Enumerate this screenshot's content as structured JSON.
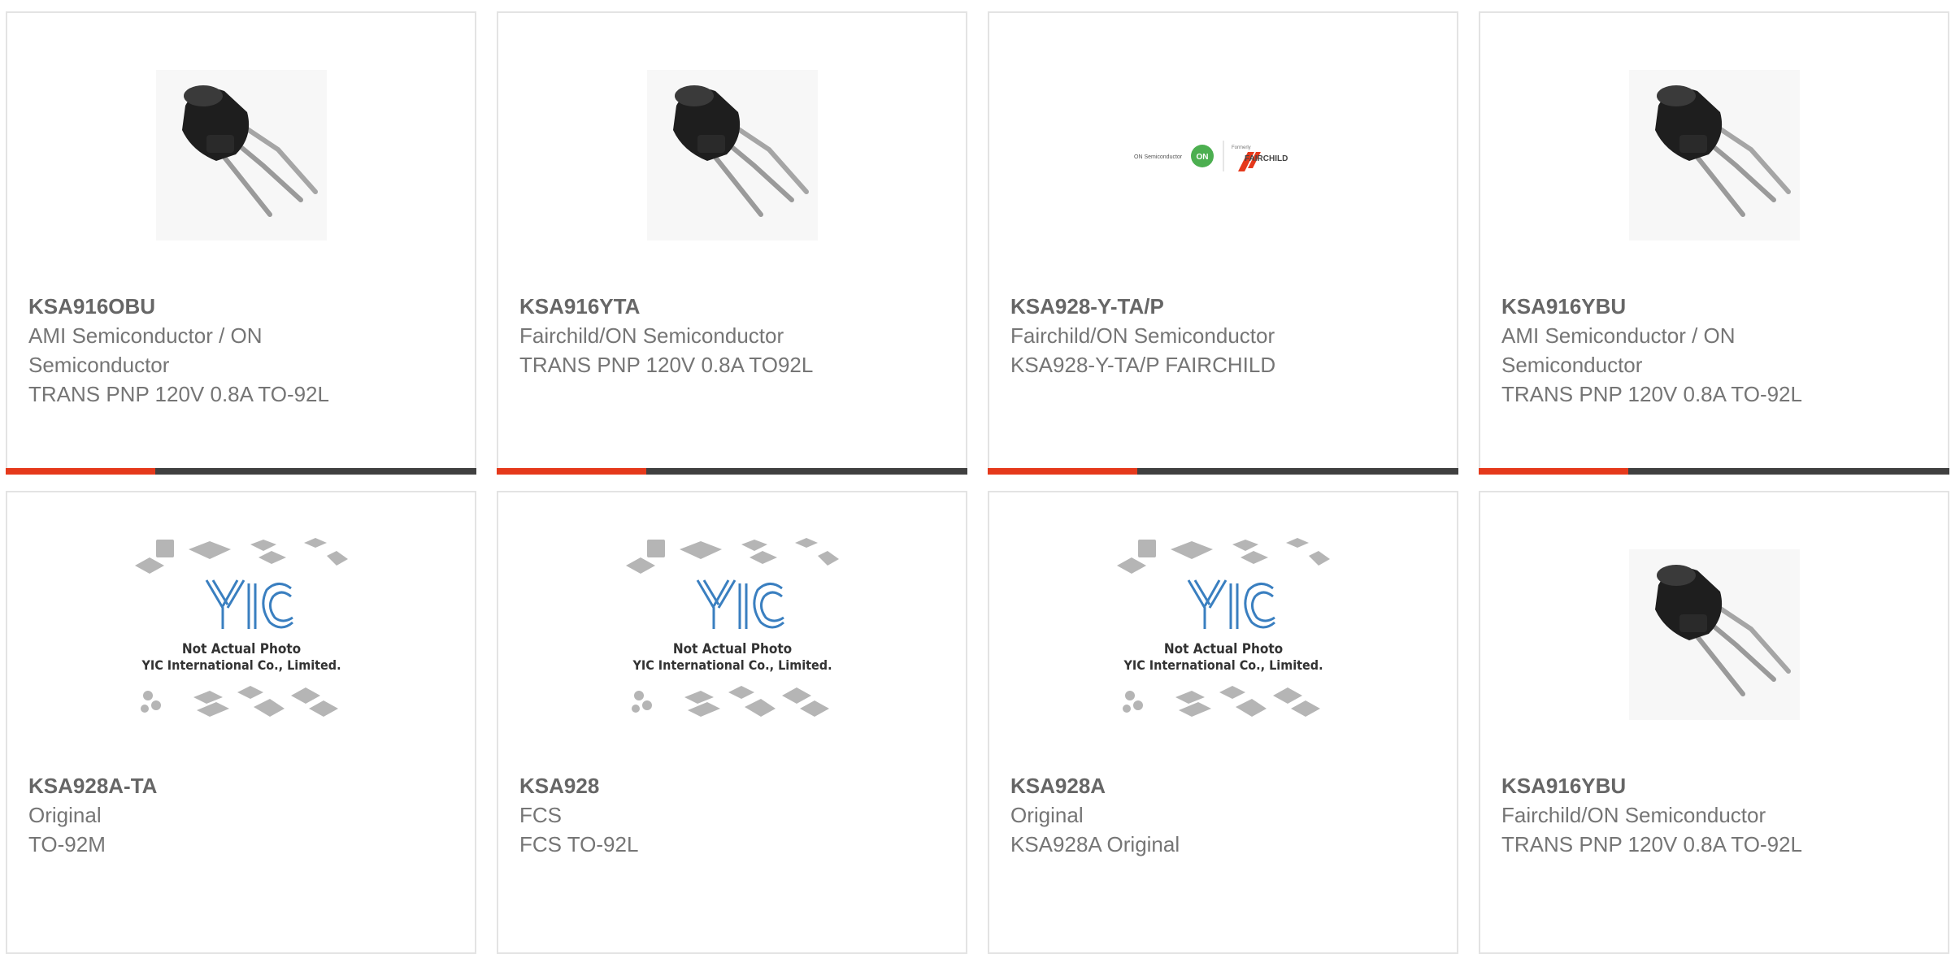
{
  "products": [
    {
      "image": "transistor-to92-photo",
      "part": "KSA916OBU",
      "lines": [
        "AMI Semiconductor / ON",
        "Semiconductor",
        "TRANS PNP 120V 0.8A TO-92L"
      ]
    },
    {
      "image": "transistor-to92-photo",
      "part": "KSA916YTA",
      "lines": [
        "Fairchild/ON Semiconductor",
        "TRANS PNP 120V 0.8A TO92L"
      ]
    },
    {
      "image": "on-semi-fairchild-logo",
      "part": "KSA928-Y-TA/P",
      "lines": [
        "Fairchild/ON Semiconductor",
        "KSA928-Y-TA/P FAIRCHILD"
      ],
      "logo": {
        "on_semi": "ON Semiconductor",
        "on_badge": "ON",
        "formerly": "Formerly",
        "fairchild": "FAIRCHILD"
      }
    },
    {
      "image": "transistor-to92-photo",
      "part": "KSA916YBU",
      "lines": [
        "AMI Semiconductor / ON",
        "Semiconductor",
        "TRANS PNP 120V 0.8A TO-92L"
      ]
    },
    {
      "image": "yic-placeholder",
      "part": "KSA928A-TA",
      "lines": [
        "Original",
        "TO-92M"
      ]
    },
    {
      "image": "yic-placeholder",
      "part": "KSA928",
      "lines": [
        "FCS",
        "FCS TO-92L"
      ]
    },
    {
      "image": "yic-placeholder",
      "part": "KSA928A",
      "lines": [
        "Original",
        "KSA928A Original"
      ]
    },
    {
      "image": "transistor-to92-photo",
      "part": "KSA916YBU",
      "lines": [
        "Fairchild/ON Semiconductor",
        "TRANS PNP 120V 0.8A TO-92L"
      ]
    }
  ],
  "placeholder": {
    "logo_text": "YIC",
    "caption_1": "Not Actual Photo",
    "caption_2": "YIC International Co., Limited."
  },
  "colors": {
    "accent": "#e5391b",
    "bar": "#404040",
    "card_border": "#e3e3e3",
    "text": "#757575",
    "part_text": "#666666",
    "yic_blue": "#3a7fc0"
  }
}
